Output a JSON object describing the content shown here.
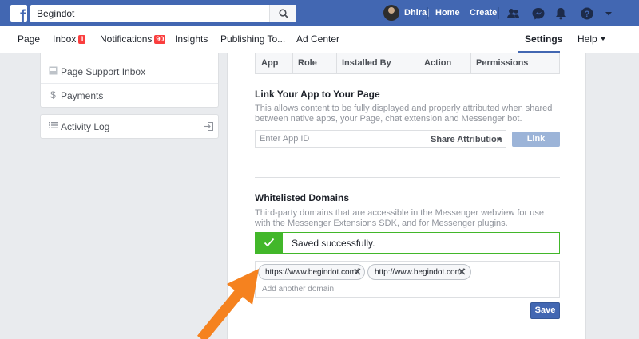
{
  "topbar": {
    "search_value": "Begindot",
    "user_name": "Dhiraj",
    "home_label": "Home",
    "create_label": "Create",
    "icons": [
      "facebook-logo",
      "search-icon",
      "friends-icon",
      "messenger-icon",
      "notifications-icon",
      "help-icon",
      "account-menu-icon"
    ]
  },
  "pagenav": {
    "page": "Page",
    "inbox": "Inbox",
    "inbox_badge": "1",
    "notifications": "Notifications",
    "notifications_badge": "90",
    "insights": "Insights",
    "publishing": "Publishing To...",
    "ad_center": "Ad Center",
    "settings": "Settings",
    "help": "Help"
  },
  "sidebar": {
    "items": [
      {
        "label": "Page Support Inbox",
        "icon": "support-inbox-icon"
      },
      {
        "label": "Payments",
        "icon": "dollar-icon"
      }
    ],
    "activity_log": {
      "label": "Activity Log",
      "icon": "list-icon",
      "action_icon": "enter-icon"
    }
  },
  "apps_table": {
    "headers": [
      "App",
      "Role",
      "Installed By",
      "Action",
      "Permissions"
    ]
  },
  "link_app": {
    "title": "Link Your App to Your Page",
    "description": "This allows content to be fully displayed and properly attributed when shared between native apps, your Page, chat extension and Messenger bot.",
    "placeholder": "Enter App ID",
    "share_attribution": "Share Attribution",
    "link_button": "Link"
  },
  "whitelisted": {
    "title": "Whitelisted Domains",
    "description": "Third-party domains that are accessible in the Messenger webview for use with the Messenger Extensions SDK, and for Messenger plugins.",
    "success_message": "Saved successfully.",
    "domains": [
      "https://www.begindot.com/",
      "http://www.begindot.com/"
    ],
    "add_placeholder": "Add another domain",
    "save_button": "Save"
  },
  "colors": {
    "brand": "#4267b2",
    "success": "#42b72a",
    "badge": "#fa3e3e",
    "annotation_arrow": "#f5821f"
  }
}
